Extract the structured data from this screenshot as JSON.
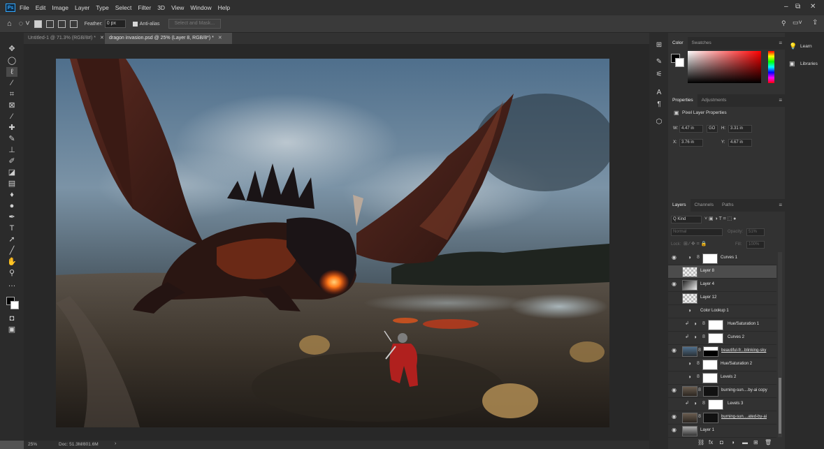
{
  "app": {
    "logo": "Ps"
  },
  "menubar": {
    "items": [
      "File",
      "Edit",
      "Image",
      "Layer",
      "Type",
      "Select",
      "Filter",
      "3D",
      "View",
      "Window",
      "Help"
    ],
    "window_controls": {
      "minimize": "–",
      "restore": "⧉",
      "close": "✕"
    },
    "right_icons": [
      "search-icon",
      "workspace-icon",
      "share-icon"
    ]
  },
  "options_bar": {
    "feather_label": "Feather:",
    "feather_value": "0 px",
    "antialias_label": "Anti-alias",
    "select_mask_label": "Select and Mask..."
  },
  "tabs": [
    {
      "label": "Untitled-1 @ 71.3% (RGB/8#) *",
      "active": false
    },
    {
      "label": "dragon invasion.psd @ 25% (Layer 8, RGB/8*) *",
      "active": true
    }
  ],
  "status": {
    "zoom": "25%",
    "doc": "Doc: 51.3M/801.6M"
  },
  "color_panel": {
    "tabs": [
      "Color",
      "Swatches"
    ]
  },
  "properties_panel": {
    "tabs": [
      "Properties",
      "Adjustments"
    ],
    "title": "Pixel Layer Properties",
    "w_label": "W:",
    "w_value": "4.47 in",
    "link": "GO",
    "h_label": "H:",
    "h_value": "3.31 in",
    "x_label": "X:",
    "x_value": "3.76 in",
    "y_label": "Y:",
    "y_value": "4.67 in"
  },
  "layers_panel": {
    "tabs": [
      "Layers",
      "Channels",
      "Paths"
    ],
    "kind_label": "Q Kind",
    "blend_mode": "Normal",
    "opacity_label": "Opacity:",
    "opacity_value": "51%",
    "lock_label": "Lock:",
    "fill_label": "Fill:",
    "fill_value": "100%",
    "layers": [
      {
        "name": "Curves 1",
        "visible": true,
        "type": "curves",
        "selected": false
      },
      {
        "name": "Layer 8",
        "visible": false,
        "type": "pixel",
        "selected": true
      },
      {
        "name": "Layer 4",
        "visible": true,
        "type": "pixel",
        "selected": false
      },
      {
        "name": "Layer 12",
        "visible": false,
        "type": "pixel",
        "selected": false
      },
      {
        "name": "Color Lookup 1",
        "visible": false,
        "type": "adjust",
        "selected": false
      },
      {
        "name": "Hue/Saturation 1",
        "visible": false,
        "type": "adjust-mask",
        "selected": false
      },
      {
        "name": "Curves 2",
        "visible": false,
        "type": "adjust-mask",
        "selected": false
      },
      {
        "name": "beautiful-fr...blinking-sky",
        "visible": true,
        "type": "smart",
        "selected": false
      },
      {
        "name": "Hue/Saturation 2",
        "visible": false,
        "type": "adjust-mask",
        "selected": false
      },
      {
        "name": "Levels 2",
        "visible": false,
        "type": "adjust-mask",
        "selected": false
      },
      {
        "name": "burning-sun....by-ai copy",
        "visible": true,
        "type": "smart",
        "selected": false
      },
      {
        "name": "Levels 3",
        "visible": false,
        "type": "adjust-mask",
        "selected": false
      },
      {
        "name": "burning-sun....ated-by-ai",
        "visible": true,
        "type": "smart",
        "selected": false
      },
      {
        "name": "Layer 1",
        "visible": true,
        "type": "pixel",
        "selected": false
      }
    ]
  },
  "right_panel": {
    "learn": "Learn",
    "libraries": "Libraries"
  }
}
